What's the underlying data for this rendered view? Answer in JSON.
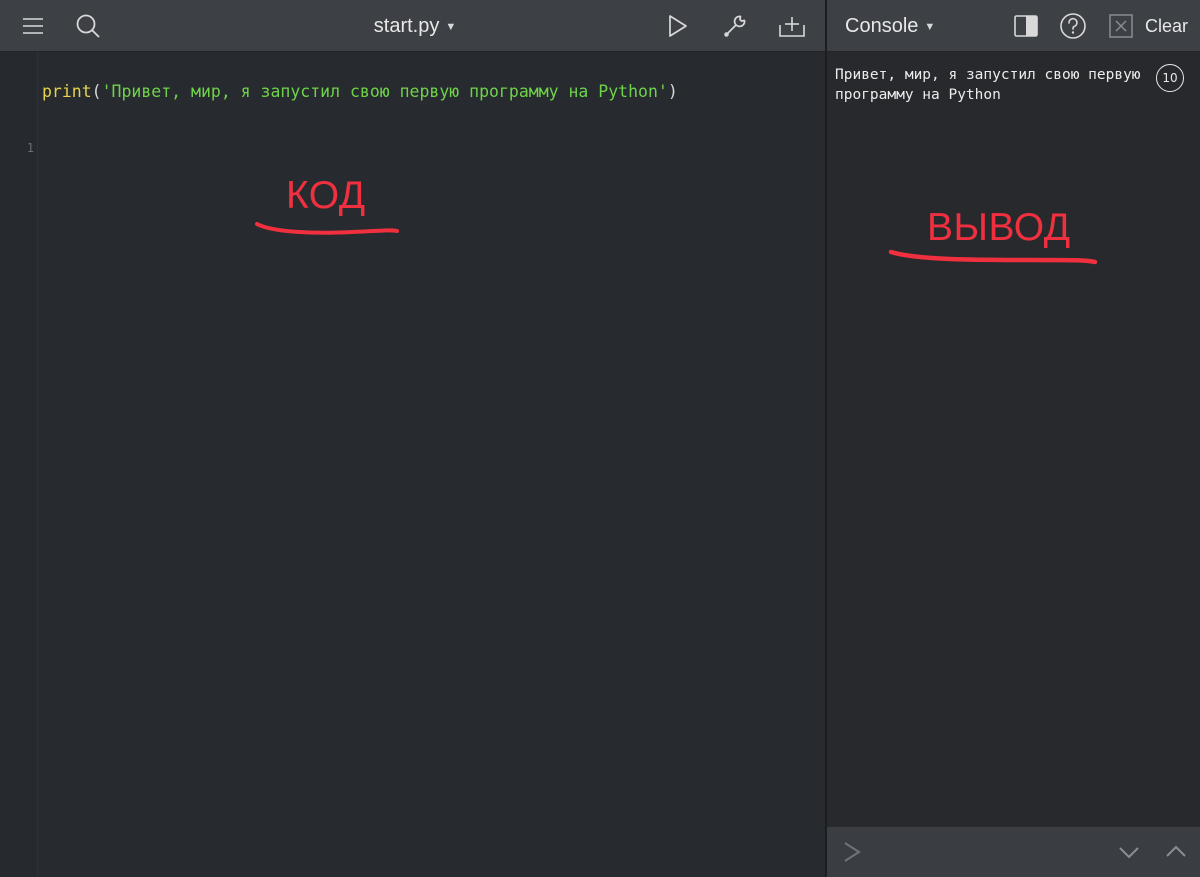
{
  "editor": {
    "file_name": "start.py",
    "toolbar_icons": [
      "hamburger-menu-icon",
      "search-icon",
      "run-play-icon",
      "wrench-icon",
      "add-file-icon"
    ],
    "line_number": "1",
    "code": {
      "fn": "print",
      "open": "(",
      "string": "'Привет, мир, я запустил свою первую программу на Python'",
      "close": ")"
    }
  },
  "annotations": {
    "code_label": "КОД",
    "output_label": "ВЫВОД",
    "color": "#f0303f"
  },
  "console": {
    "title": "Console",
    "clear_label": "Clear",
    "output_text": "Привет, мир, я запустил свою первую программу на Python",
    "badge_text": "10",
    "toolbar_icons": [
      "split-view-icon",
      "help-icon",
      "close-box-icon"
    ],
    "input_icons": [
      "prompt-chevron-icon",
      "history-down-icon",
      "history-up-icon"
    ]
  },
  "colors": {
    "background": "#272a2e",
    "toolbar": "#3d4045",
    "function_yellow": "#e6d34a",
    "string_green": "#6fd34a"
  }
}
